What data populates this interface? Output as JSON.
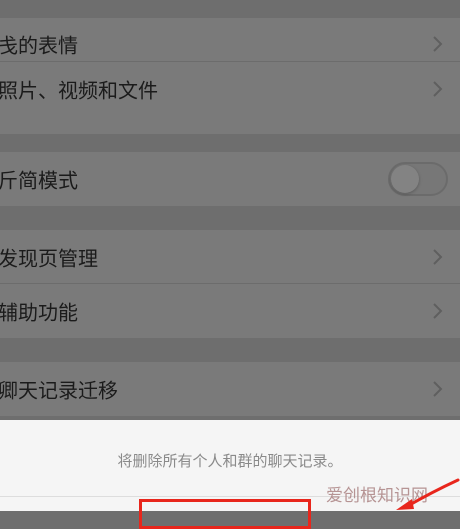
{
  "settings": {
    "group1": {
      "items": [
        {
          "label": "戋的表情"
        },
        {
          "label": "照片、视频和文件"
        }
      ]
    },
    "group2": {
      "items": [
        {
          "label": "斤简模式",
          "toggle_on": false
        }
      ]
    },
    "group3": {
      "items": [
        {
          "label": "发现页管理"
        },
        {
          "label": "辅助功能"
        }
      ]
    },
    "group4": {
      "items": [
        {
          "label": "卿天记录迁移"
        }
      ]
    }
  },
  "sheet": {
    "message": "将删除所有个人和群的聊天记录。"
  },
  "watermark": {
    "text": "爱创根知识网"
  },
  "colors": {
    "dim_background": "#6e6e6e",
    "row_background": "#7a7a7a",
    "sheet_background": "#f5f5f5",
    "highlight": "#e8261c"
  }
}
